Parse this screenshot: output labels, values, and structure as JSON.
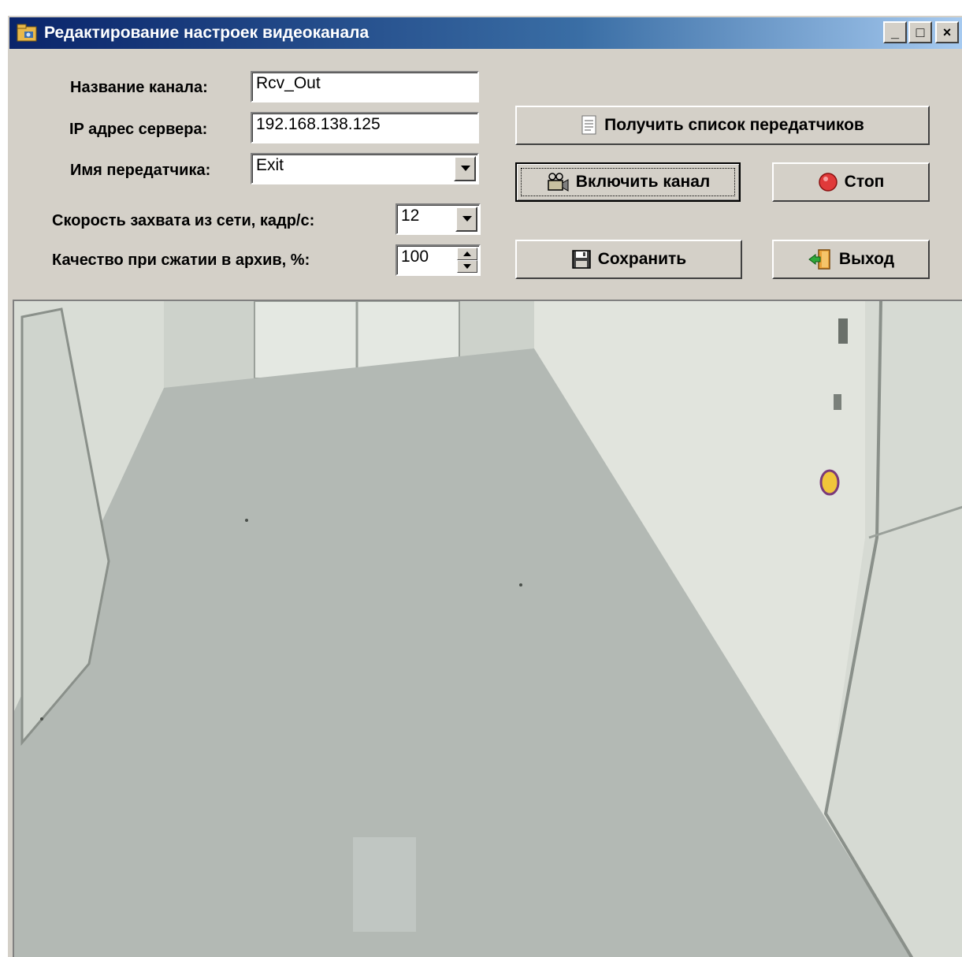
{
  "window": {
    "title": "Редактирование настроек видеоканала",
    "caption_buttons": {
      "minimize": "_",
      "maximize": "□",
      "close": "×"
    }
  },
  "form": {
    "channel_name": {
      "label": "Название канала:",
      "value": "Rcv_Out"
    },
    "server_ip": {
      "label": "IP адрес сервера:",
      "value": "192.168.138.125"
    },
    "transmitter_name": {
      "label": "Имя передатчика:",
      "value": "Exit"
    },
    "capture_speed": {
      "label": "Скорость захвата из сети, кадр/с:",
      "value": "12"
    },
    "archive_quality": {
      "label": "Качество при сжатии в архив, %:",
      "value": "100"
    }
  },
  "buttons": {
    "get_transmitters": "Получить список передатчиков",
    "enable_channel": "Включить канал",
    "stop": "Стоп",
    "save": "Сохранить",
    "exit": "Выход"
  },
  "icons": {
    "window": "folder-camera-icon",
    "get_transmitters": "document-list-icon",
    "enable_channel": "video-camera-icon",
    "stop": "stop-circle-icon",
    "save": "floppy-disk-icon",
    "exit": "exit-door-icon"
  },
  "colors": {
    "dialog_face": "#d4d0c8",
    "titlebar_start": "#0a246a",
    "titlebar_end": "#a6caf0",
    "stop_red": "#e03a3a"
  }
}
